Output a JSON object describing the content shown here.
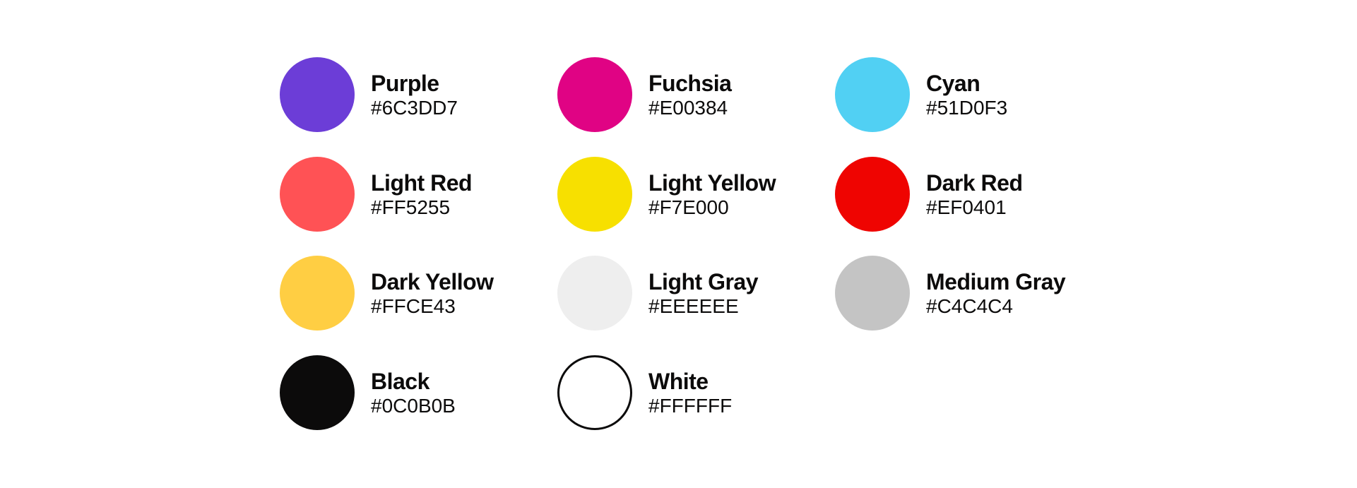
{
  "swatches": [
    {
      "name": "Purple",
      "hex": "#6C3DD7",
      "color": "#6C3DD7"
    },
    {
      "name": "Fuchsia",
      "hex": "#E00384",
      "color": "#E00384"
    },
    {
      "name": "Cyan",
      "hex": "#51D0F3",
      "color": "#51D0F3"
    },
    {
      "name": "Light Red",
      "hex": "#FF5255",
      "color": "#FF5255"
    },
    {
      "name": "Light Yellow",
      "hex": "#F7E000",
      "color": "#F7E000"
    },
    {
      "name": "Dark Red",
      "hex": "#EF0401",
      "color": "#EF0401"
    },
    {
      "name": "Dark Yellow",
      "hex": "#FFCE43",
      "color": "#FFCE43"
    },
    {
      "name": "Light Gray",
      "hex": "#EEEEEE",
      "color": "#EEEEEE"
    },
    {
      "name": "Medium Gray",
      "hex": "#C4C4C4",
      "color": "#C4C4C4"
    },
    {
      "name": "Black",
      "hex": "#0C0B0B",
      "color": "#0C0B0B"
    },
    {
      "name": "White",
      "hex": "#FFFFFF",
      "color": "#FFFFFF",
      "outlined": true
    }
  ]
}
